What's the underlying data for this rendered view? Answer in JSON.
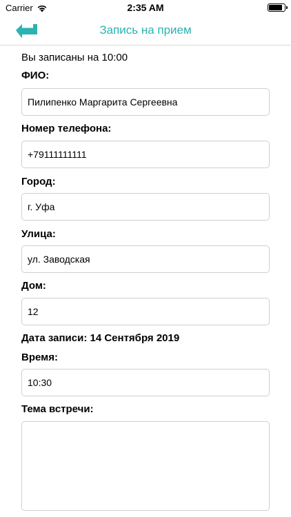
{
  "status": {
    "carrier": "Carrier",
    "time": "2:35 AM"
  },
  "nav": {
    "title": "Запись на прием"
  },
  "info_text": "Вы записаны на 10:00",
  "form": {
    "fio_label": "ФИО:",
    "fio_value": "Пилипенко Маргарита Сергеевна",
    "phone_label": "Номер телефона:",
    "phone_value": "+79111111111",
    "city_label": "Город:",
    "city_value": "г. Уфа",
    "street_label": "Улица:",
    "street_value": "ул. Заводская",
    "house_label": "Дом:",
    "house_value": "12",
    "date_text": "Дата записи: 14 Сентября 2019",
    "time_label": "Время:",
    "time_value": "10:30",
    "topic_label": "Тема встречи:",
    "topic_value": ""
  },
  "colors": {
    "accent": "#2bb3b1",
    "border": "#cfcfcf",
    "divider": "#d9d9d9"
  }
}
